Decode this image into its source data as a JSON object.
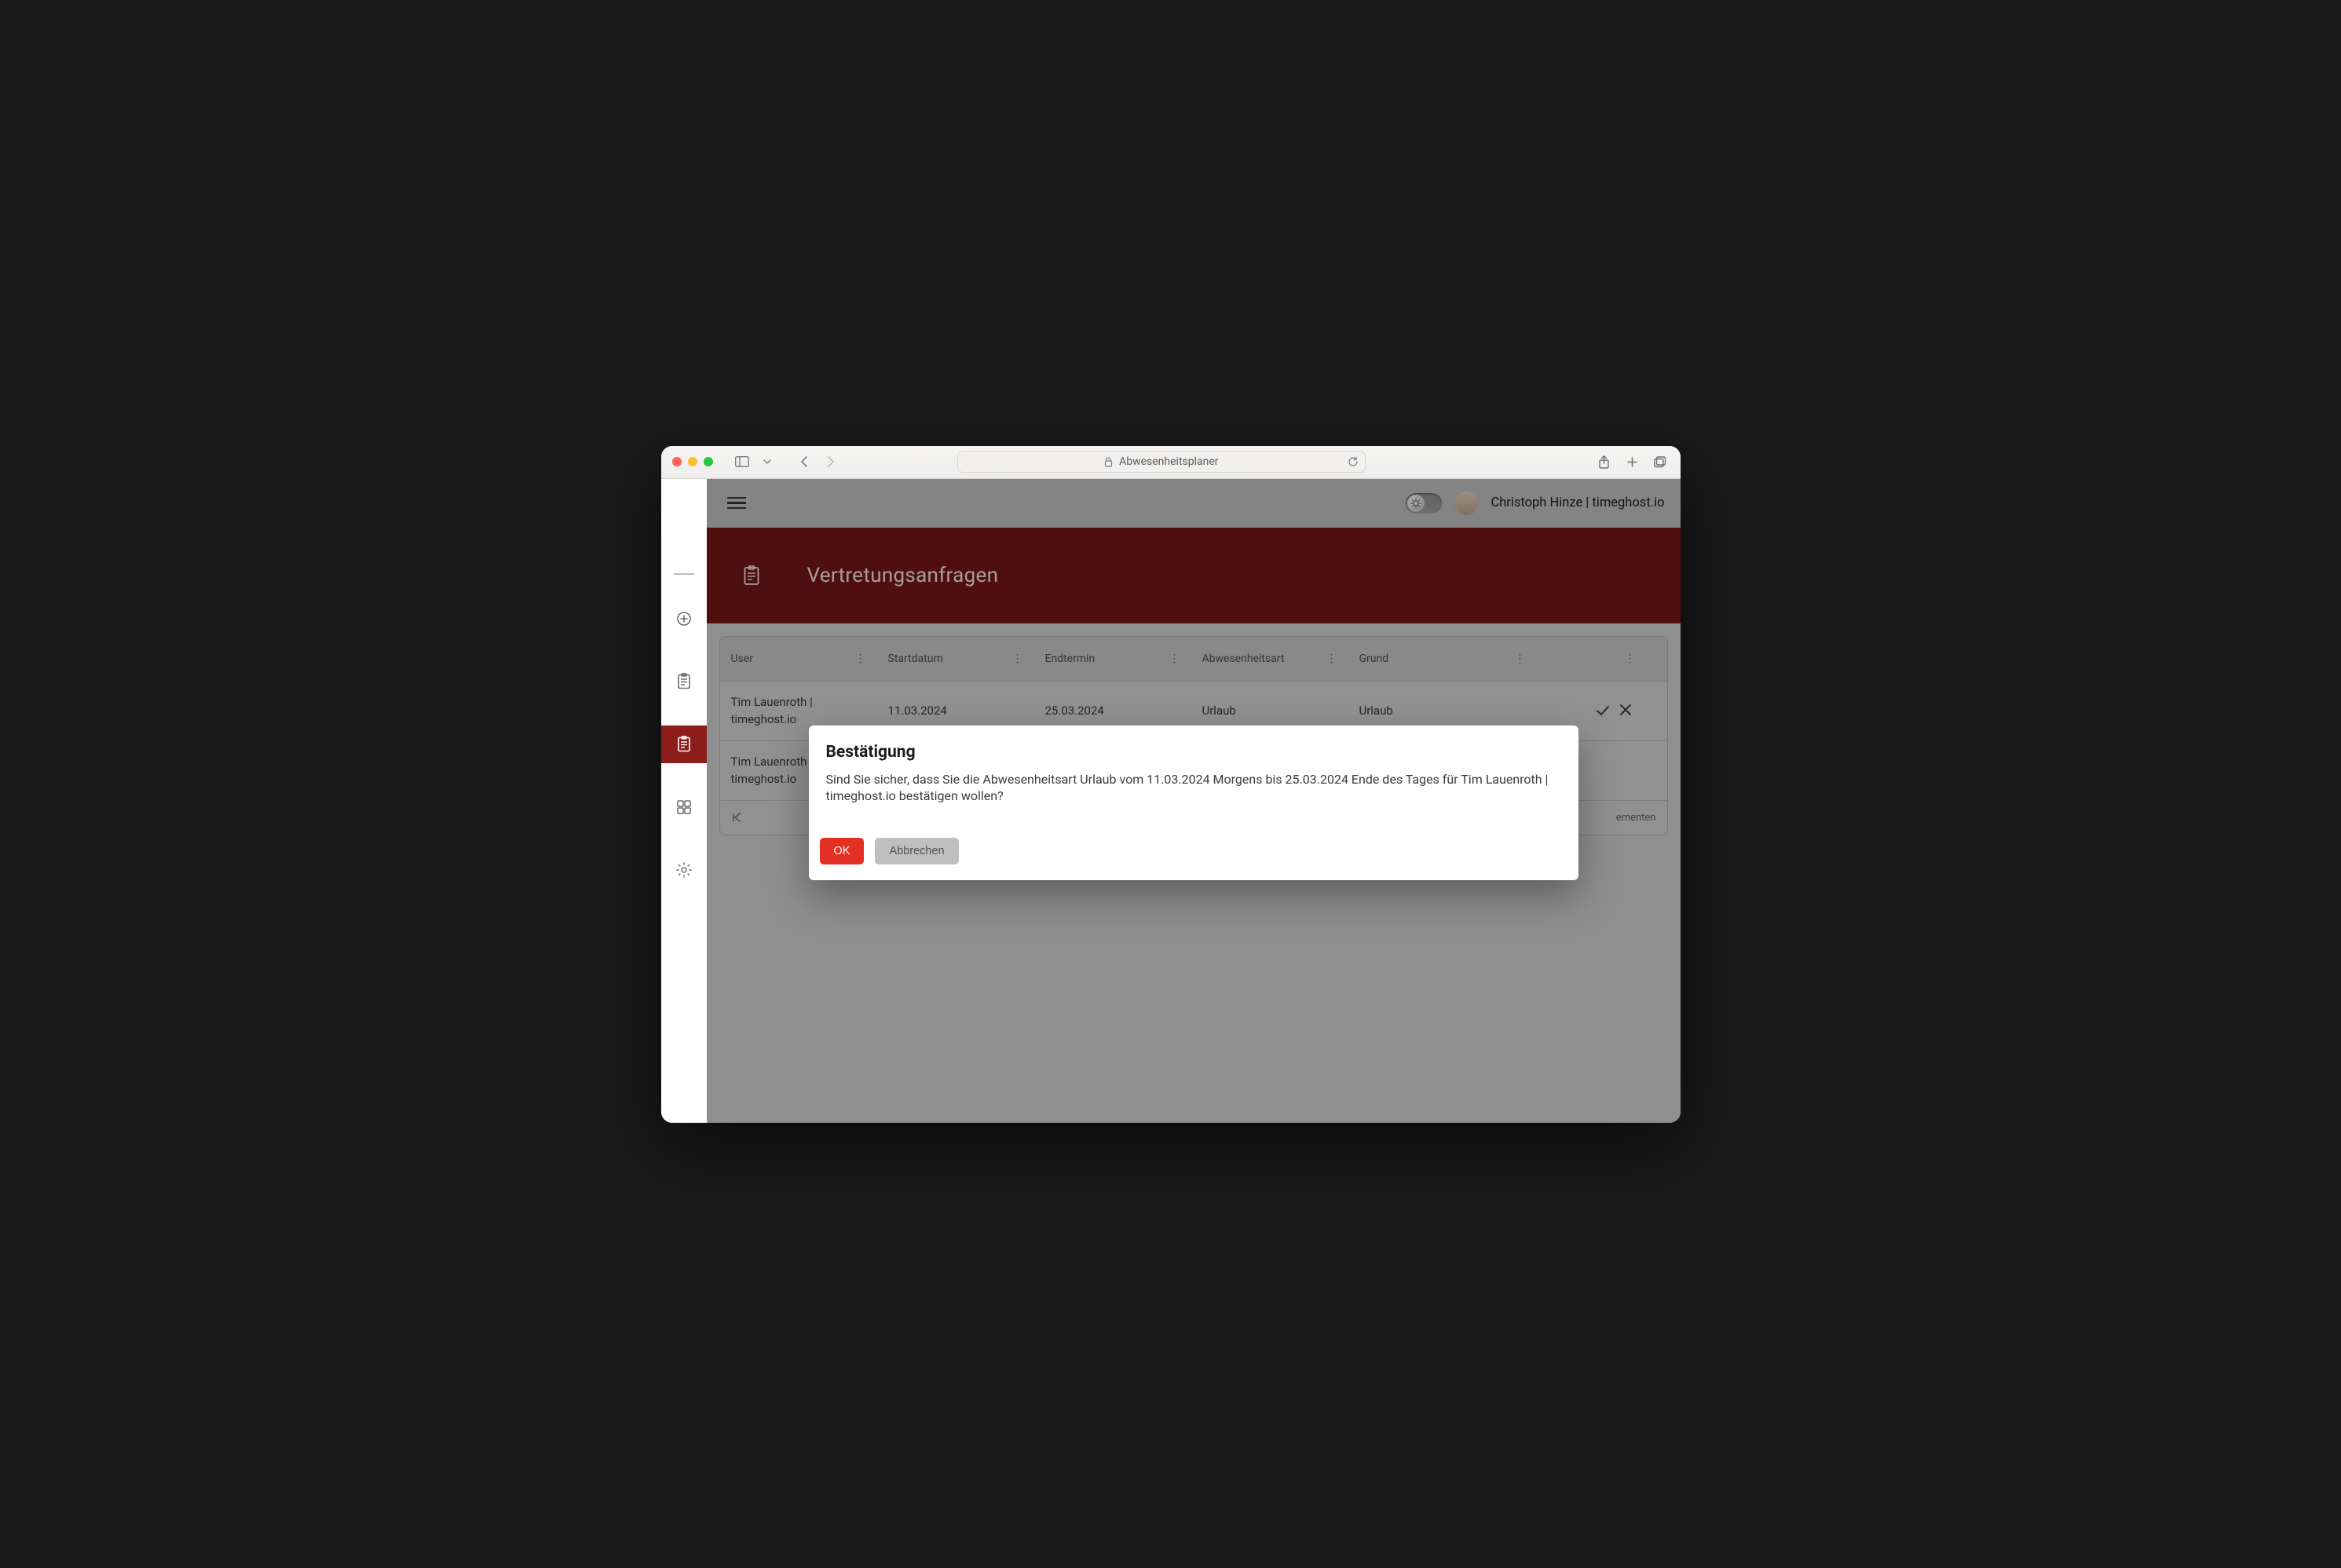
{
  "browser": {
    "title": "Abwesenheitsplaner"
  },
  "header": {
    "user_display": "Christoph Hinze | timeghost.io"
  },
  "page": {
    "title": "Vertretungsanfragen"
  },
  "sidebar": {
    "items": [
      {
        "name": "add"
      },
      {
        "name": "clipboard"
      },
      {
        "name": "requests",
        "active": true
      },
      {
        "name": "dashboard"
      },
      {
        "name": "settings"
      }
    ]
  },
  "table": {
    "columns": {
      "user": "User",
      "startdate": "Startdatum",
      "enddate": "Endtermin",
      "absence_type": "Abwesenheitsart",
      "reason": "Grund"
    },
    "rows": [
      {
        "user": "Tim Lauenroth | timeghost.io",
        "startdate": "11.03.2024",
        "enddate": "25.03.2024",
        "absence_type": "Urlaub",
        "reason": "Urlaub"
      },
      {
        "user": "Tim Lauenroth | timeghost.io",
        "startdate": "",
        "enddate": "",
        "absence_type": "",
        "reason": ""
      }
    ],
    "pager_suffix": "ementen"
  },
  "modal": {
    "title": "Bestätigung",
    "body": "Sind Sie sicher, dass Sie die Abwesenheitsart Urlaub vom 11.03.2024 Morgens bis 25.03.2024 Ende des Tages für Tim Lauenroth | timeghost.io bestätigen wollen?",
    "ok": "OK",
    "cancel": "Abbrechen"
  },
  "colors": {
    "brand_dark_red": "#6e1615",
    "accent_red": "#e42f24"
  }
}
